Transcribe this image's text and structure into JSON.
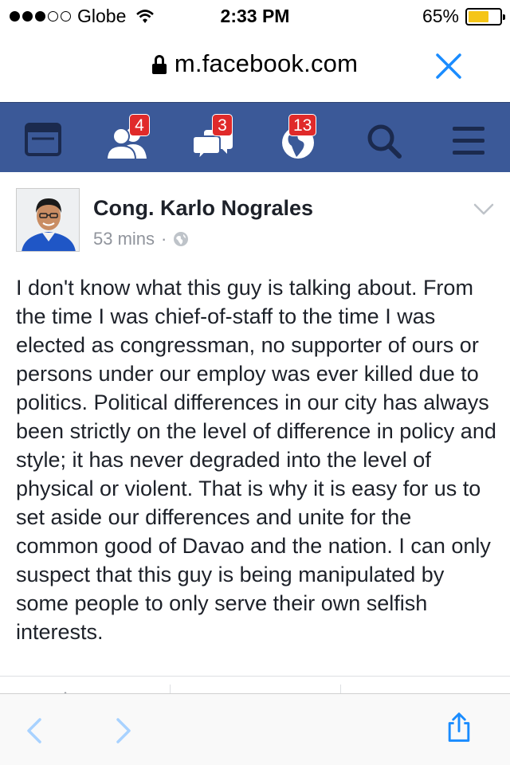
{
  "status_bar": {
    "carrier": "Globe",
    "time": "2:33 PM",
    "battery": "65%",
    "battery_level": 0.65,
    "signal_bars_filled": 3,
    "signal_bars_total": 5
  },
  "url_bar": {
    "domain": "m.facebook.com"
  },
  "nav": {
    "friend_requests_badge": "4",
    "messages_badge": "3",
    "notifications_badge": "13"
  },
  "post": {
    "author": "Cong. Karlo Nograles",
    "time": "53 mins",
    "separator": "·",
    "body": "I don't know what this guy is talking about. From the time I was chief-of-staff to the time I was elected as congressman, no supporter of ours or persons under our employ was ever killed due to politics. Political differences in our city has always been strictly on the level of difference in policy and style; it has never degraded into the level of physical or violent. That is why it is easy for us to set aside our differences and unite for the common good of Davao and the nation. I can only suspect that this guy is being manipulated by some people to only serve their own selfish interests."
  },
  "colors": {
    "facebook_blue": "#3b5998",
    "badge_red": "#e02a2a",
    "ios_blue": "#1a8cff",
    "battery_yellow": "#f5c518"
  }
}
